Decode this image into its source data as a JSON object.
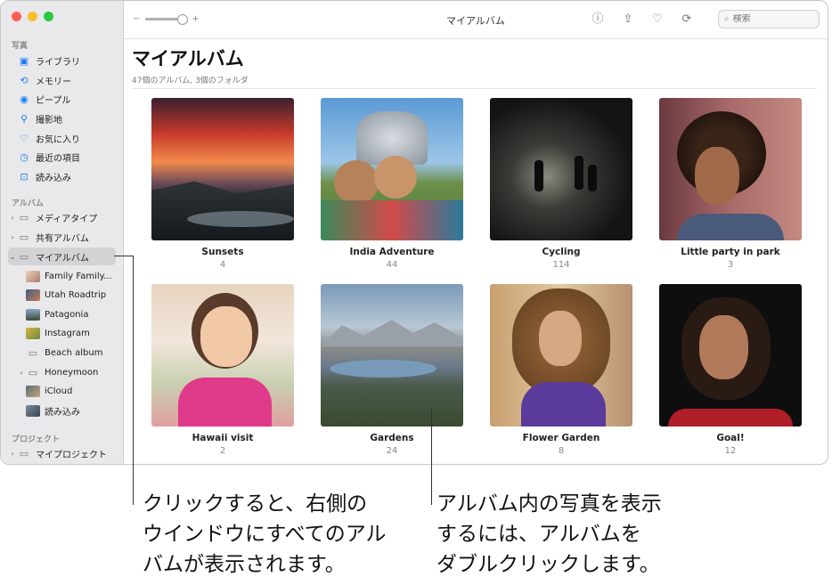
{
  "window": {
    "title": "マイアルバム"
  },
  "toolbar": {
    "zoom_minus": "−",
    "zoom_plus": "+",
    "search_placeholder": "検索"
  },
  "sidebar": {
    "section_photos": "写真",
    "photos": [
      "ライブラリ",
      "メモリー",
      "ピープル",
      "撮影地",
      "お気に入り",
      "最近の項目",
      "読み込み"
    ],
    "section_albums": "アルバム",
    "albums": [
      "メディアタイプ",
      "共有アルバム",
      "マイアルバム"
    ],
    "my_albums": [
      "Family Family...",
      "Utah Roadtrip",
      "Patagonia",
      "Instagram",
      "Beach album",
      "Honeymoon",
      "iCloud",
      "読み込み"
    ],
    "section_projects": "プロジェクト",
    "projects": [
      "マイプロジェクト"
    ]
  },
  "main": {
    "heading": "マイアルバム",
    "subtitle": "47個のアルバム, 3個のフォルダ",
    "albums": [
      {
        "name": "Sunsets",
        "count": "4"
      },
      {
        "name": "India Adventure",
        "count": "44"
      },
      {
        "name": "Cycling",
        "count": "114"
      },
      {
        "name": "Little party in park",
        "count": "3"
      },
      {
        "name": "Hawaii visit",
        "count": "2"
      },
      {
        "name": "Gardens",
        "count": "24"
      },
      {
        "name": "Flower Garden",
        "count": "8"
      },
      {
        "name": "Goal!",
        "count": "12"
      }
    ]
  },
  "callouts": {
    "left": "クリックすると、右側の\nウインドウにすべてのアル\nバムが表示されます。",
    "right": "アルバム内の写真を表示\nするには、アルバムを\nダブルクリックします。"
  },
  "colors": {
    "accent": "#1b7cf5",
    "sidebar_bg": "#e9e9eb",
    "selected": "#d3d3d6"
  }
}
